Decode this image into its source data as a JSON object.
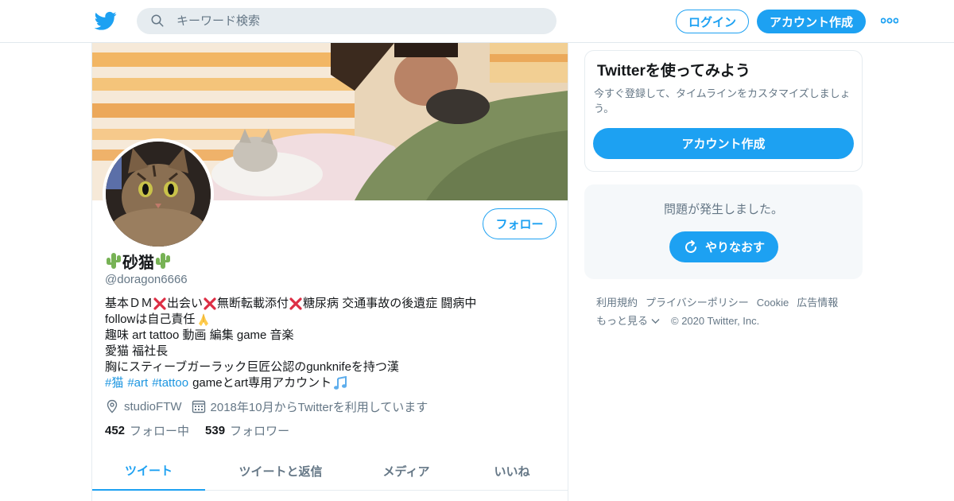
{
  "colors": {
    "accent": "#1da1f2",
    "link": "#1b95e0",
    "secondary_text": "#657786",
    "border": "#e6ecf0"
  },
  "header": {
    "logo_icon": "twitter-bird-icon",
    "search_placeholder": "キーワード検索",
    "login_label": "ログイン",
    "signup_label": "アカウント作成",
    "more_icon": "more-dots-icon"
  },
  "profile": {
    "display_name": "砂猫",
    "handle": "@doragon6666",
    "follow_label": "フォロー",
    "bio": {
      "line1": {
        "a": "基本ＤＭ",
        "b": "出会い",
        "c": "無断転載添付",
        "d": "糖尿病 交通事故の後遺症 闘病中"
      },
      "line2": "followは自己責任",
      "line3": "趣味 art tattoo 動画 編集 game 音楽",
      "line4": "愛猫 福社長",
      "line5": "胸にスティーブガーラック巨匠公認のgunknifeを持つ漢",
      "line6": {
        "tags": [
          "#猫",
          "#art",
          "#tattoo"
        ],
        "text": "gameとart専用アカウント"
      }
    },
    "location": "studioFTW",
    "joined": "2018年10月からTwitterを利用しています",
    "following_count": "452",
    "following_label": "フォロー中",
    "followers_count": "539",
    "followers_label": "フォロワー",
    "tabs": [
      {
        "label": "ツイート"
      },
      {
        "label": "ツイートと返信"
      },
      {
        "label": "メディア"
      },
      {
        "label": "いいね"
      }
    ]
  },
  "sidebar": {
    "promo_title": "Twitterを使ってみよう",
    "promo_desc": "今すぐ登録して、タイムラインをカスタマイズしましょう。",
    "promo_button": "アカウント作成",
    "error_message": "問題が発生しました。",
    "retry_button": "やりなおす"
  },
  "footer": {
    "links": [
      "利用規約",
      "プライバシーポリシー",
      "Cookie",
      "広告情報"
    ],
    "more": "もっと見る",
    "copyright": "© 2020 Twitter, Inc."
  }
}
